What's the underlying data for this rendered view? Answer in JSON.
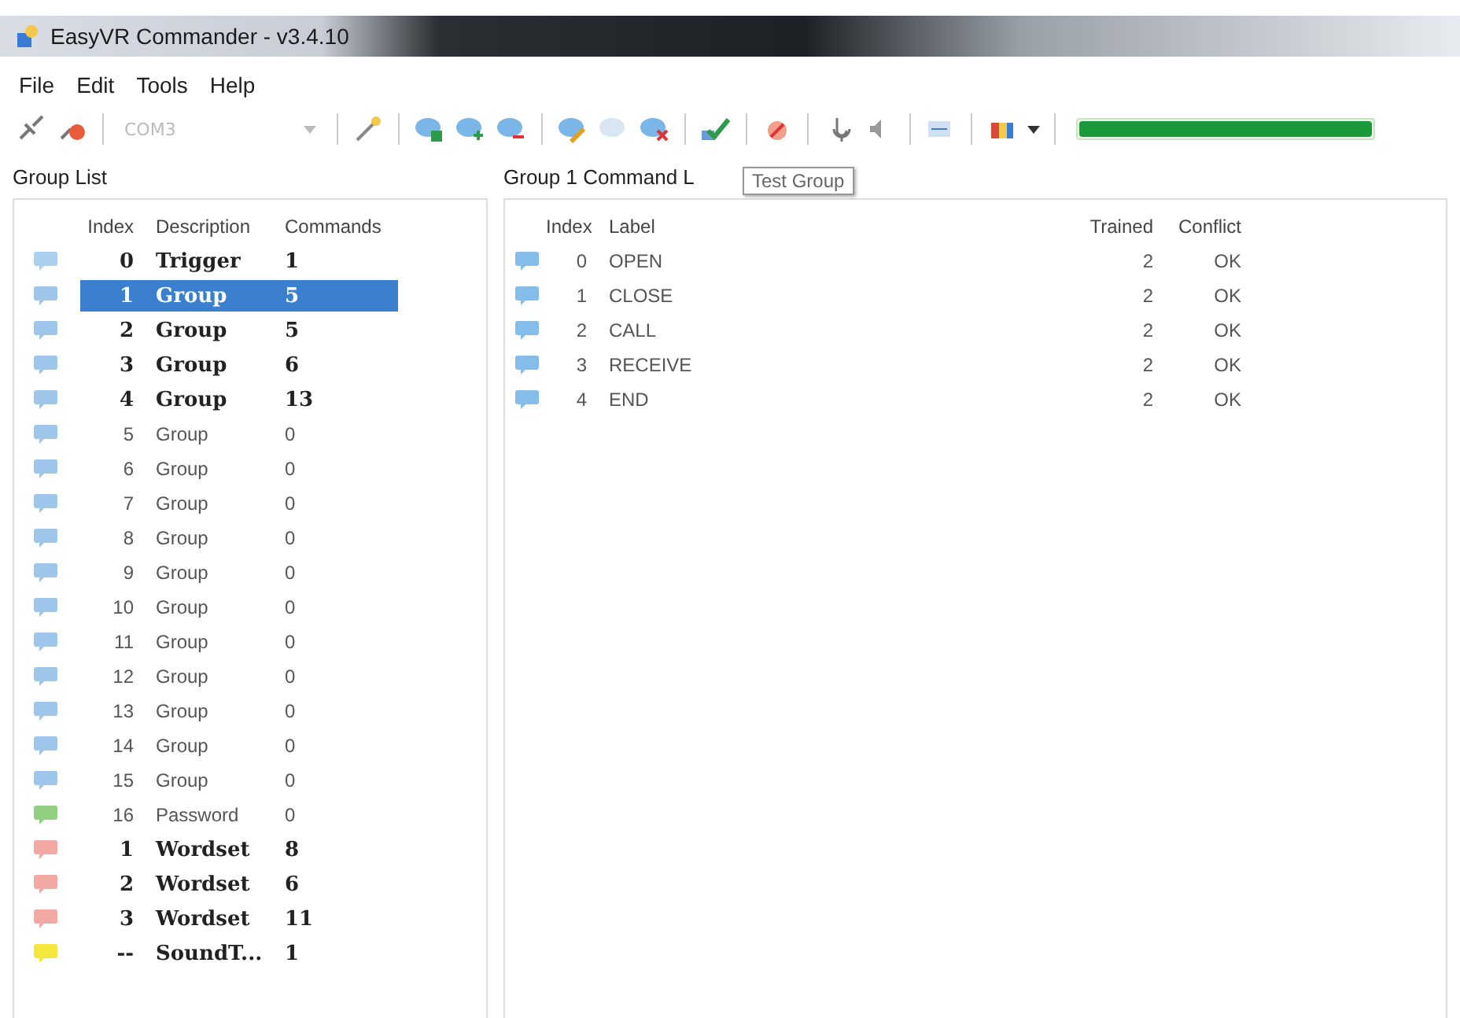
{
  "window": {
    "title": "EasyVR Commander - v3.4.10"
  },
  "menu": [
    "File",
    "Edit",
    "Tools",
    "Help"
  ],
  "toolbar": {
    "port": {
      "value": "COM3",
      "disabled": true
    },
    "meter": {
      "level": 1
    }
  },
  "group_list": {
    "title": "Group List",
    "columns": [
      "Index",
      "Description",
      "Commands"
    ],
    "rows": [
      {
        "kind": "trigger",
        "index": "0",
        "description": "Trigger",
        "commands": "1",
        "bold": true,
        "selected": false
      },
      {
        "kind": "group",
        "index": "1",
        "description": "Group",
        "commands": "5",
        "bold": true,
        "selected": true
      },
      {
        "kind": "group",
        "index": "2",
        "description": "Group",
        "commands": "5",
        "bold": true,
        "selected": false
      },
      {
        "kind": "group",
        "index": "3",
        "description": "Group",
        "commands": "6",
        "bold": true,
        "selected": false
      },
      {
        "kind": "group",
        "index": "4",
        "description": "Group",
        "commands": "13",
        "bold": true,
        "selected": false
      },
      {
        "kind": "group",
        "index": "5",
        "description": "Group",
        "commands": "0",
        "bold": false,
        "selected": false
      },
      {
        "kind": "group",
        "index": "6",
        "description": "Group",
        "commands": "0",
        "bold": false,
        "selected": false
      },
      {
        "kind": "group",
        "index": "7",
        "description": "Group",
        "commands": "0",
        "bold": false,
        "selected": false
      },
      {
        "kind": "group",
        "index": "8",
        "description": "Group",
        "commands": "0",
        "bold": false,
        "selected": false
      },
      {
        "kind": "group",
        "index": "9",
        "description": "Group",
        "commands": "0",
        "bold": false,
        "selected": false
      },
      {
        "kind": "group",
        "index": "10",
        "description": "Group",
        "commands": "0",
        "bold": false,
        "selected": false
      },
      {
        "kind": "group",
        "index": "11",
        "description": "Group",
        "commands": "0",
        "bold": false,
        "selected": false
      },
      {
        "kind": "group",
        "index": "12",
        "description": "Group",
        "commands": "0",
        "bold": false,
        "selected": false
      },
      {
        "kind": "group",
        "index": "13",
        "description": "Group",
        "commands": "0",
        "bold": false,
        "selected": false
      },
      {
        "kind": "group",
        "index": "14",
        "description": "Group",
        "commands": "0",
        "bold": false,
        "selected": false
      },
      {
        "kind": "group",
        "index": "15",
        "description": "Group",
        "commands": "0",
        "bold": false,
        "selected": false
      },
      {
        "kind": "password",
        "index": "16",
        "description": "Password",
        "commands": "0",
        "bold": false,
        "selected": false
      },
      {
        "kind": "wordset",
        "index": "1",
        "description": "Wordset",
        "commands": "8",
        "bold": true,
        "selected": false
      },
      {
        "kind": "wordset",
        "index": "2",
        "description": "Wordset",
        "commands": "6",
        "bold": true,
        "selected": false
      },
      {
        "kind": "wordset",
        "index": "3",
        "description": "Wordset",
        "commands": "11",
        "bold": true,
        "selected": false
      },
      {
        "kind": "sound",
        "index": "--",
        "description": "SoundT...",
        "commands": "1",
        "bold": true,
        "selected": false
      }
    ]
  },
  "command_list": {
    "title": "Group 1 Command L",
    "tooltip": "Test Group",
    "columns": [
      "Index",
      "Label",
      "Trained",
      "Conflict"
    ],
    "rows": [
      {
        "index": "0",
        "label": "OPEN",
        "trained": "2",
        "conflict": "OK"
      },
      {
        "index": "1",
        "label": "CLOSE",
        "trained": "2",
        "conflict": "OK"
      },
      {
        "index": "2",
        "label": "CALL",
        "trained": "2",
        "conflict": "OK"
      },
      {
        "index": "3",
        "label": "RECEIVE",
        "trained": "2",
        "conflict": "OK"
      },
      {
        "index": "4",
        "label": "END",
        "trained": "2",
        "conflict": "OK"
      }
    ]
  }
}
